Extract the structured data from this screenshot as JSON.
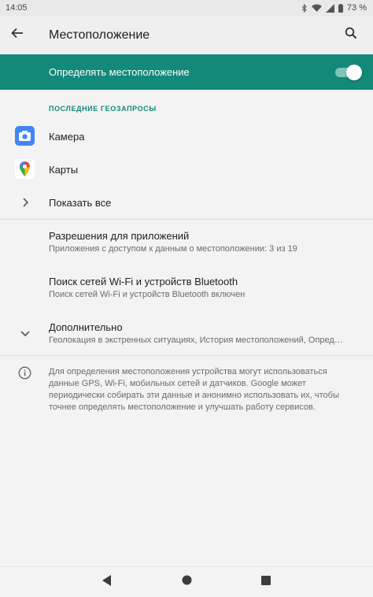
{
  "status_bar": {
    "time": "14:05",
    "battery": "73 %",
    "icons": [
      "bluetooth-icon",
      "wifi-icon",
      "signal-icon",
      "battery-icon"
    ]
  },
  "app_bar": {
    "title": "Местоположение",
    "back_icon": "arrow-back-icon",
    "search_icon": "search-icon"
  },
  "master_switch": {
    "label": "Определять местоположение",
    "enabled": true,
    "background": "#13897a"
  },
  "recent_section": {
    "header": "ПОСЛЕДНИЕ ГЕОЗАПРОСЫ",
    "items": [
      {
        "label": "Камера",
        "icon": "camera-app-icon"
      },
      {
        "label": "Карты",
        "icon": "maps-app-icon"
      }
    ],
    "show_all": "Показать все"
  },
  "settings": [
    {
      "title": "Разрешения для приложений",
      "summary": "Приложения с доступом к данным о местоположении: 3 из 19"
    },
    {
      "title": "Поиск сетей Wi-Fi и устройств Bluetooth",
      "summary": "Поиск сетей Wi-Fi и устройств Bluetooth включен"
    },
    {
      "title": "Дополнительно",
      "summary": "Геолокация в экстренных ситуациях, История местоположений, Опред…"
    }
  ],
  "info": {
    "icon": "info-icon",
    "text": "Для определения местоположения устройства могут использоваться данные GPS, Wi-Fi, мобильных сетей и датчиков. Google может периодически собирать эти данные и анонимно использовать их, чтобы точнее определять местоположение и улучшать работу сервисов."
  },
  "nav_bar": {
    "buttons": [
      "back-nav-icon",
      "home-nav-icon",
      "recents-nav-icon"
    ]
  }
}
